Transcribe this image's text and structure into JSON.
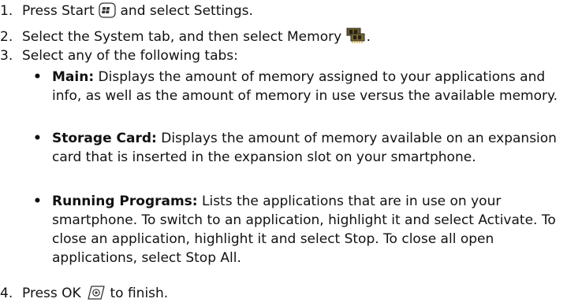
{
  "steps": [
    {
      "number": "1.",
      "before": "Press Start",
      "icon": "start-button-icon",
      "after": "and select Settings."
    },
    {
      "number": "2.",
      "before": "Select the System tab, and then select Memory",
      "icon": "memory-chip-icon",
      "after": "."
    },
    {
      "number": "3.",
      "text": "Select any of the following tabs:"
    },
    {
      "number": "4.",
      "before": "Press OK",
      "icon": "ok-button-icon",
      "after": "to finish."
    }
  ],
  "bullets": [
    {
      "label": "Main:",
      "text": "Displays the amount of memory assigned to your applications and info, as well as the amount of memory in use versus the available memory."
    },
    {
      "label": "Storage Card:",
      "text": "Displays the amount of memory available on an expansion card that is inserted in the expansion slot on your smartphone."
    },
    {
      "label": "Running Programs:",
      "text": "Lists the applications that are in use on your smartphone. To switch to an application, highlight it and select Activate. To close an application, highlight it and select Stop. To close all open applications, select Stop All."
    }
  ]
}
